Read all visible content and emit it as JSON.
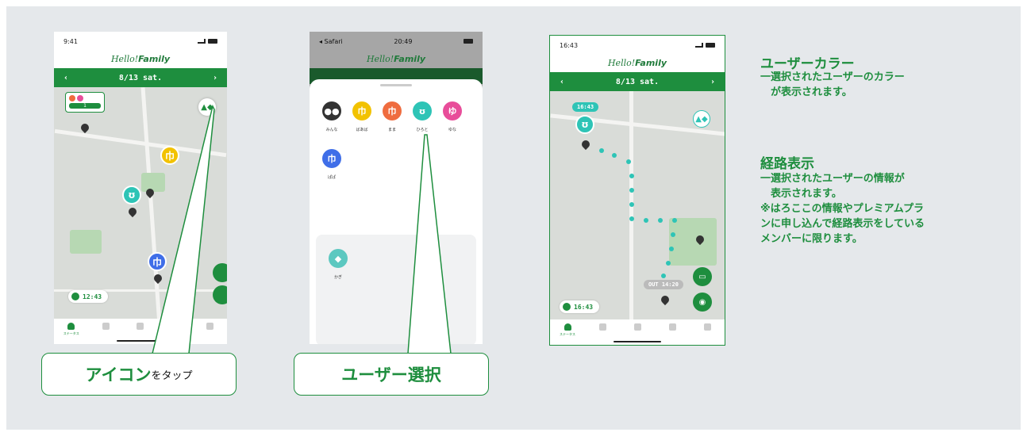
{
  "phone1": {
    "time": "9:41",
    "logo_a": "Hello!",
    "logo_b": "Family",
    "date": "8/13 sat.",
    "prev": "‹",
    "next": "›",
    "badge_count": "1",
    "clock_time": "12:43",
    "tab_label": "ステータス"
  },
  "phone2": {
    "status_left": "◂ Safari",
    "time": "20:49",
    "logo_a": "Hello!",
    "logo_b": "Family",
    "users": [
      {
        "label": "みんな",
        "color": "#333333"
      },
      {
        "label": "ばあば",
        "color": "#f2c200"
      },
      {
        "label": "まま",
        "color": "#ef6c3f"
      },
      {
        "label": "ひろと",
        "color": "#2ec4b6"
      },
      {
        "label": "ゆな",
        "color": "#e84d9a"
      }
    ],
    "user_papa": {
      "label": "ぱぱ",
      "color": "#3f6ee8"
    },
    "item_label": "かぎ"
  },
  "phone3": {
    "time": "16:43",
    "logo_a": "Hello!",
    "logo_b": "Family",
    "date": "8/13 sat.",
    "prev": "‹",
    "next": "›",
    "user_time": "16:43",
    "out_label": "OUT 14:20",
    "clock_time": "16:43",
    "tab_label": "ステータス"
  },
  "callouts": {
    "icon_main": "アイコン",
    "icon_tap": "をタップ",
    "user_select": "ユーザー選択"
  },
  "descriptions": {
    "color_title": "ユーザーカラー",
    "color_body_1": "一選択されたユーザーのカラー",
    "color_body_2": "が表示されます。",
    "route_title": "経路表示",
    "route_body_1": "一選択されたユーザーの情報が",
    "route_body_2": "表示されます。",
    "route_body_3": "※はろここの情報やプレミアムプラ",
    "route_body_4": "ンに申し込んで経路表示をしている",
    "route_body_5": "メンバーに限ります。"
  },
  "colors": {
    "brand_green": "#1e8e3e",
    "route_teal": "#2ec4b6",
    "background": "#e5e8eb"
  }
}
